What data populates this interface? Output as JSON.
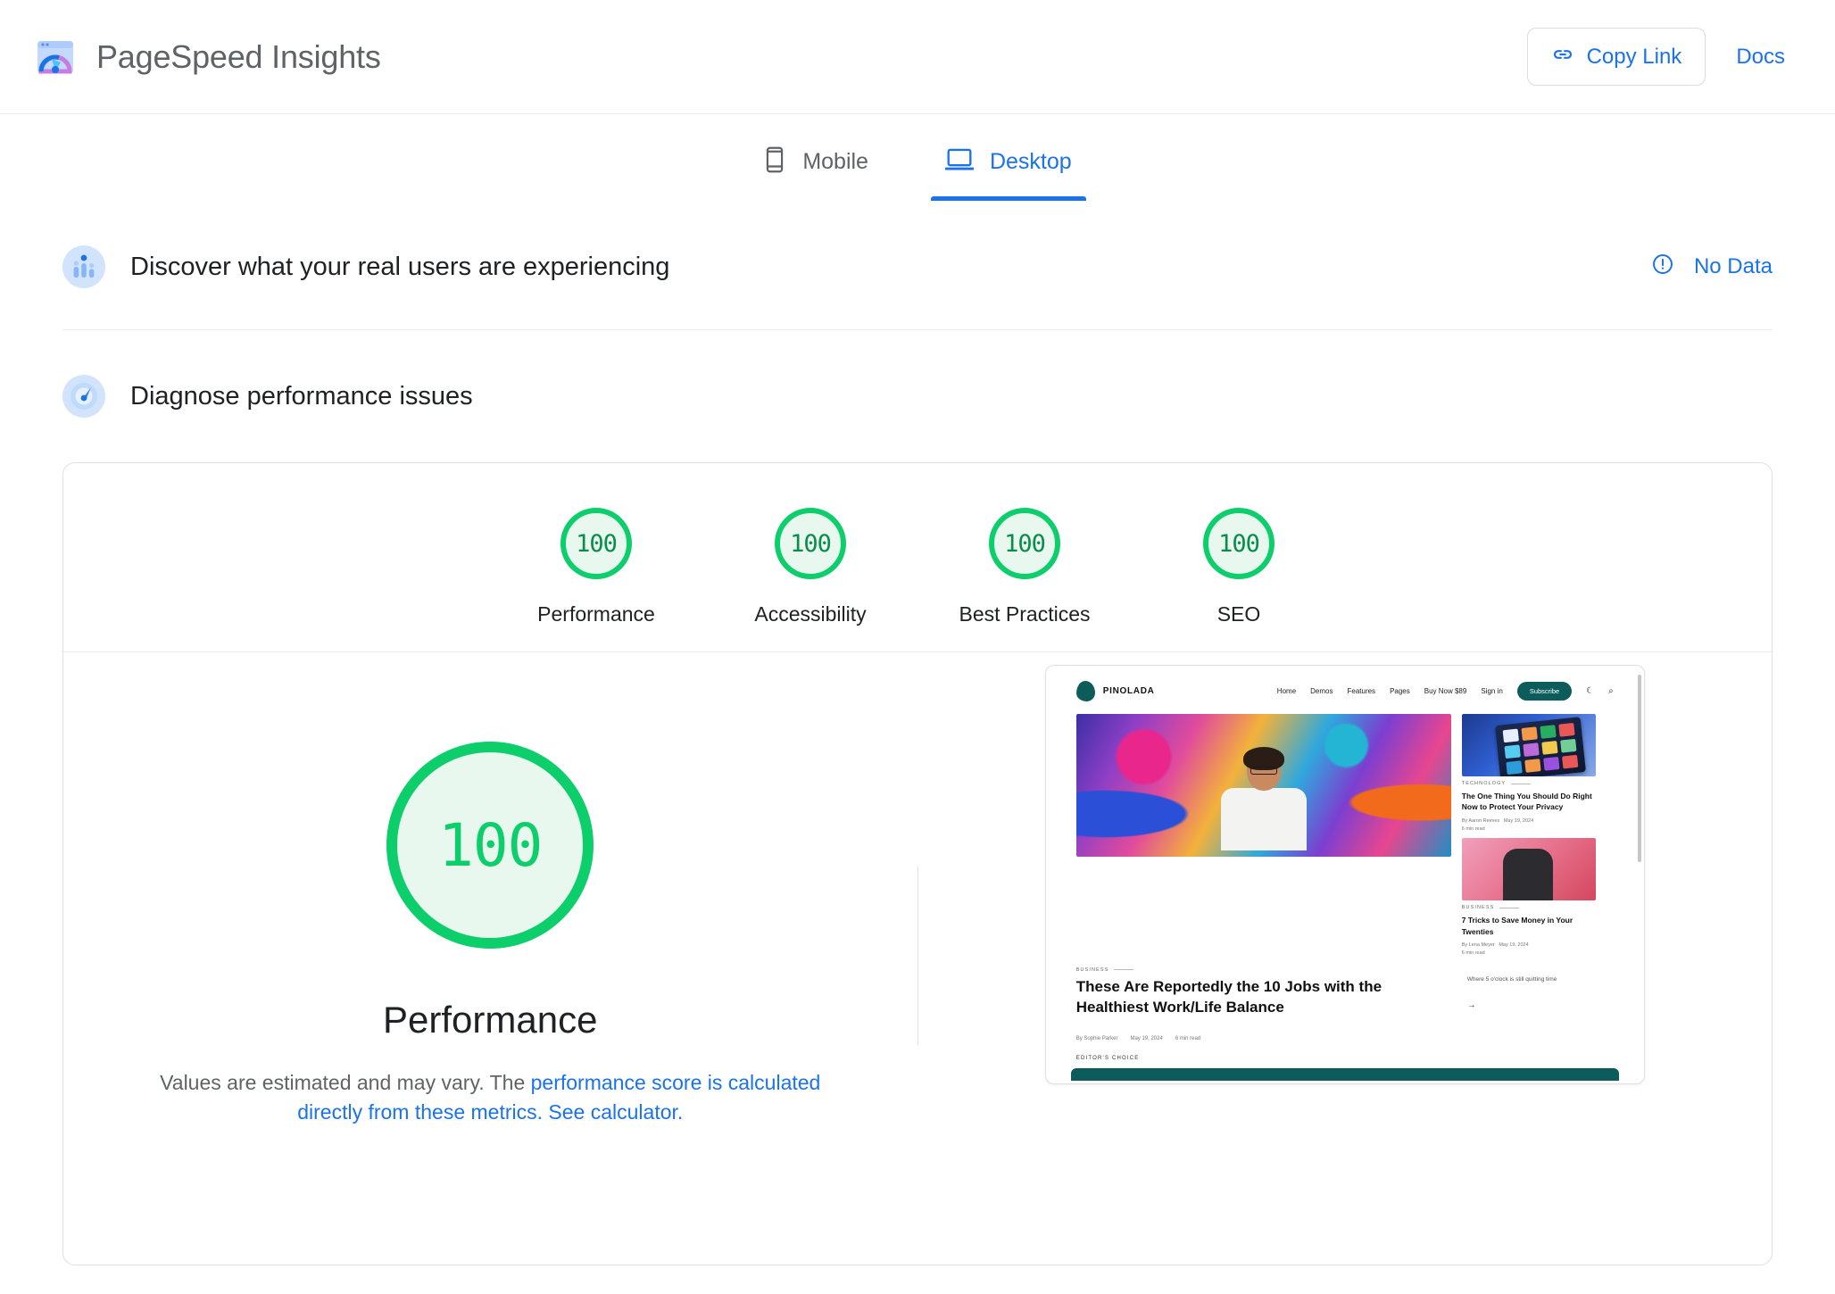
{
  "header": {
    "logo_icon": "pagespeed-logo-icon",
    "title": "PageSpeed Insights",
    "copy_link_label": "Copy Link",
    "copy_link_icon": "link-icon",
    "docs_label": "Docs"
  },
  "tabs": [
    {
      "label": "Mobile",
      "icon": "mobile-icon",
      "active": false
    },
    {
      "label": "Desktop",
      "icon": "desktop-icon",
      "active": true
    }
  ],
  "sections": {
    "field_data": {
      "icon": "real-users-icon",
      "title": "Discover what your real users are experiencing",
      "status_label": "No Data",
      "status_icon": "error-outline-icon"
    },
    "lab_data": {
      "icon": "gauge-icon",
      "title": "Diagnose performance issues"
    }
  },
  "scores": [
    {
      "label": "Performance",
      "value": "100"
    },
    {
      "label": "Accessibility",
      "value": "100"
    },
    {
      "label": "Best Practices",
      "value": "100"
    },
    {
      "label": "SEO",
      "value": "100"
    }
  ],
  "performance": {
    "value": "100",
    "title": "Performance",
    "desc_part1": "Values are estimated and may vary. The ",
    "desc_link1": "performance score is calculated directly from these metrics.",
    "desc_link2": "See calculator."
  },
  "colors": {
    "score_green": "#0cce6b",
    "score_green_bg": "#e8f8ef",
    "score_green_text": "#0a8c4a",
    "link_blue": "#1a73e8",
    "text_primary": "#202124",
    "text_secondary": "#5f6368",
    "border": "#e0e0e0",
    "site_teal": "#0d5c5c"
  },
  "screenshot": {
    "site_name": "PINOLADA",
    "nav": [
      "Home",
      "Demos",
      "Features",
      "Pages",
      "Buy Now $89",
      "Sign in"
    ],
    "subscribe_label": "Subscribe",
    "dark_mode_icon": "moon-icon",
    "search_icon": "search-icon",
    "main_article": {
      "category": "BUSINESS",
      "title": "These Are Reportedly the 10 Jobs with the Healthiest Work/Life Balance",
      "excerpt": "Where 5 o'clock is still quitting time",
      "author": "By Sophie Parker",
      "date": "May 19, 2024",
      "read_time": "6 min read"
    },
    "side_articles": [
      {
        "category": "TECHNOLOGY",
        "title": "The One Thing You Should Do Right Now to Protect Your Privacy",
        "author": "By Aaron Reeves",
        "date": "May 19, 2024",
        "read_time": "6 min read"
      },
      {
        "category": "BUSINESS",
        "title": "7 Tricks to Save Money in Your Twenties",
        "author": "By Lena Meyer",
        "date": "May 19, 2024",
        "read_time": "6 min read"
      }
    ],
    "editors_choice_label": "EDITOR'S CHOICE"
  }
}
